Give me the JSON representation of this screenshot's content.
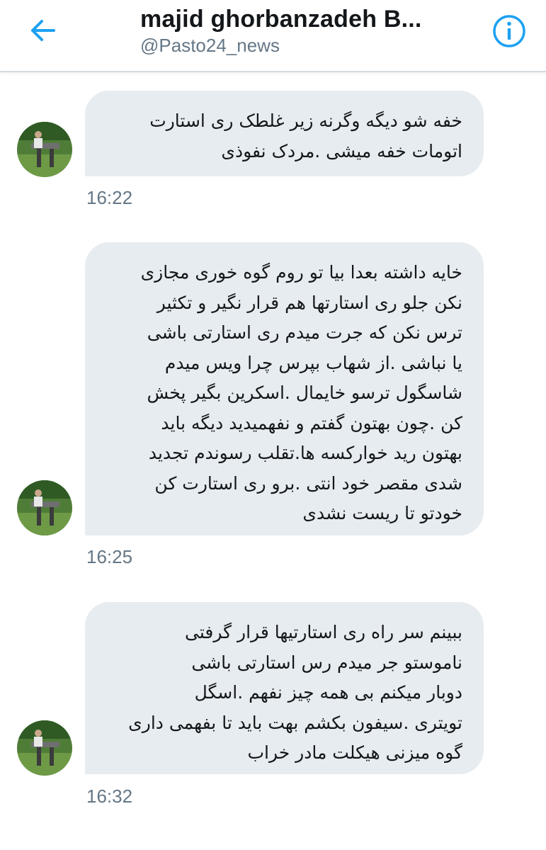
{
  "header": {
    "title": "majid ghorbanzadeh B...",
    "handle": "@Pasto24_news",
    "back_icon": "back-arrow-icon",
    "info_icon": "info-icon",
    "accent_color": "#1da1f2"
  },
  "messages": [
    {
      "lines": [
        "خفه شو دیگه وگرنه زیر غلطک ری استارت",
        "اتومات خفه میشی .مردک نفوذی"
      ],
      "time": "16:22"
    },
    {
      "lines": [
        "خایه داشته بعدا بیا تو روم گوه خوری مجازی",
        "نکن جلو ری استارتها هم قرار نگیر و تکثیر",
        "ترس نکن که جرت میدم ری استارتی باشی",
        "یا نباشی .از شهاب بپرس چرا ویس میدم",
        "شاسگول ترسو خایمال .اسکرین بگیر پخش",
        "کن .چون بهتون گفتم و نفهمیدید دیگه باید",
        "بهتون رید خوارکسه ها.تقلب رسوندم تجدید",
        "شدی مقصر خود انتی .برو ری استارت کن",
        "خودتو تا ریست نشدی"
      ],
      "time": "16:25"
    },
    {
      "lines": [
        "ببینم سر راه ری استارتیها قرار گرفتی",
        "ناموستو جر میدم رس استارتی باشی",
        "دوبار میکنم بی همه چیز نفهم .اسگل",
        "تویتری .سیفون بکشم بهت باید تا بفهمی داری",
        "گوه میزنی هیکلت مادر خراب"
      ],
      "time": "16:32"
    }
  ]
}
